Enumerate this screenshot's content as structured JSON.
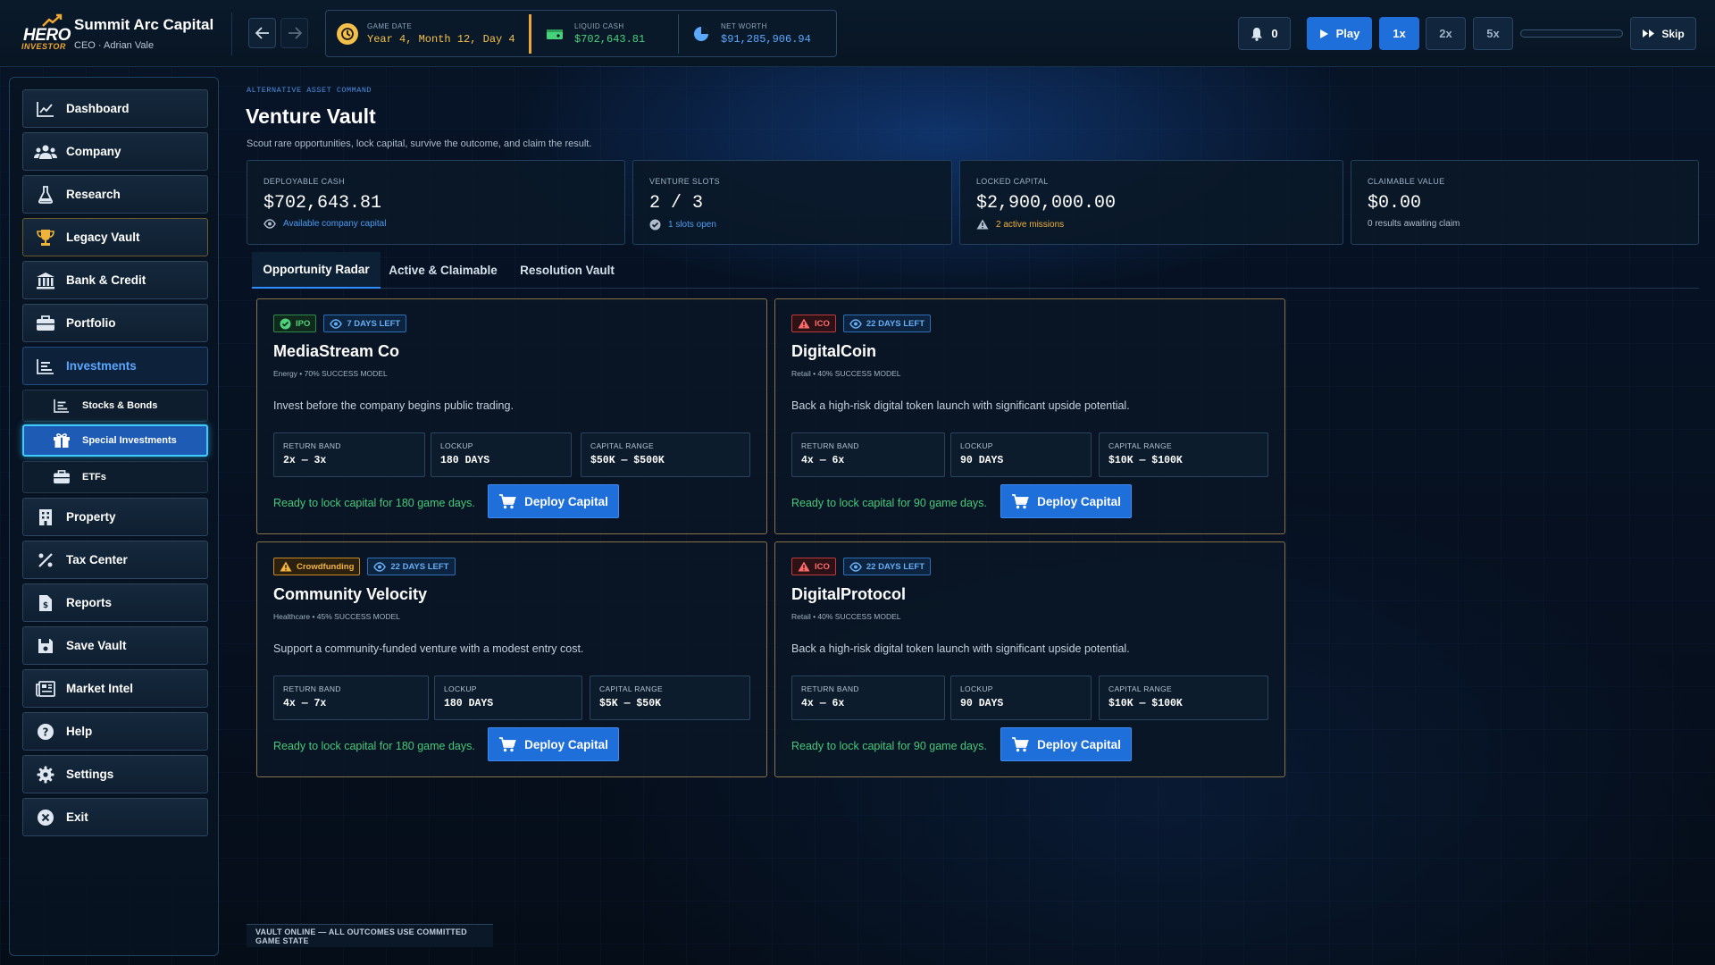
{
  "header": {
    "company": "Summit Arc Capital",
    "ceo": "CEO · Adrian Vale",
    "logo_top": "HERO",
    "logo_bottom": "INVESTOR",
    "stats": [
      {
        "label": "GAME DATE",
        "value": "Year 4, Month 12, Day 4",
        "color": "#f4c04a",
        "icon": "clock-icon"
      },
      {
        "label": "LIQUID CASH",
        "value": "$702,643.81",
        "color": "#46d17a",
        "icon": "cash-icon"
      },
      {
        "label": "NET WORTH",
        "value": "$91,285,906.94",
        "color": "#5aa9ff",
        "icon": "pie-chart-icon"
      }
    ],
    "notifications": "0",
    "play_label": "Play",
    "speeds": [
      "1x",
      "2x",
      "5x"
    ],
    "speed_selected": "1x",
    "progress": 0.0,
    "skip_label": "Skip"
  },
  "sidebar": {
    "items": [
      {
        "label": "Dashboard",
        "icon": "line-chart-icon"
      },
      {
        "label": "Company",
        "icon": "users-icon"
      },
      {
        "label": "Research",
        "icon": "flask-icon"
      },
      {
        "label": "Legacy Vault",
        "icon": "trophy-icon"
      },
      {
        "label": "Bank & Credit",
        "icon": "bank-icon"
      },
      {
        "label": "Portfolio",
        "icon": "briefcase-icon"
      },
      {
        "label": "Investments",
        "icon": "list-chart-icon"
      }
    ],
    "sub_items": [
      {
        "label": "Stocks & Bonds",
        "icon": "list-chart-icon"
      },
      {
        "label": "Special Investments",
        "icon": "gift-icon"
      },
      {
        "label": "ETFs",
        "icon": "briefcase-icon"
      }
    ],
    "items_after": [
      {
        "label": "Property",
        "icon": "building-icon"
      },
      {
        "label": "Tax Center",
        "icon": "percent-icon"
      },
      {
        "label": "Reports",
        "icon": "report-icon"
      },
      {
        "label": "Save Vault",
        "icon": "save-icon"
      },
      {
        "label": "Market Intel",
        "icon": "newspaper-icon"
      },
      {
        "label": "Help",
        "icon": "help-icon"
      },
      {
        "label": "Settings",
        "icon": "gear-icon"
      },
      {
        "label": "Exit",
        "icon": "close-icon"
      }
    ]
  },
  "main": {
    "eyebrow": "ALTERNATIVE ASSET COMMAND",
    "title": "Venture Vault",
    "subtitle": "Scout rare opportunities, lock capital, survive the outcome, and claim the result.",
    "kpis": [
      {
        "label": "DEPLOYABLE CASH",
        "value": "$702,643.81",
        "note": "Available company capital",
        "note_color": "#4d9cf0",
        "icon": "eye-icon"
      },
      {
        "label": "VENTURE SLOTS",
        "value": "2 / 3",
        "note": "1 slots open",
        "note_color": "#4d9cf0",
        "icon": "check-circle-icon"
      },
      {
        "label": "LOCKED CAPITAL",
        "value": "$2,900,000.00",
        "note": "2 active missions",
        "note_color": "#f0b03a",
        "icon": "warning-icon"
      },
      {
        "label": "CLAIMABLE VALUE",
        "value": "$0.00",
        "note": "0 results awaiting claim",
        "note_color": "#aebccb",
        "icon": ""
      }
    ],
    "tabs": [
      "Opportunity Radar",
      "Active & Claimable",
      "Resolution Vault"
    ],
    "tab_selected": "Opportunity Radar",
    "metric_labels": [
      "RETURN BAND",
      "LOCKUP",
      "CAPITAL RANGE"
    ],
    "deploy_label": "Deploy Capital",
    "cards": [
      {
        "type": "IPO",
        "type_class": "ipo",
        "days": "7 DAYS LEFT",
        "name": "MediaStream Co",
        "meta": "Energy • 70% SUCCESS MODEL",
        "desc": "Invest before the company begins public trading.",
        "return": "2x — 3x",
        "lockup": "180 DAYS",
        "range": "$50K — $500K",
        "ready": "Ready to lock capital for 180 game days."
      },
      {
        "type": "ICO",
        "type_class": "ico",
        "days": "22 DAYS LEFT",
        "name": "DigitalCoin",
        "meta": "Retail • 40% SUCCESS MODEL",
        "desc": "Back a high-risk digital token launch with significant upside potential.",
        "return": "4x — 6x",
        "lockup": "90 DAYS",
        "range": "$10K — $100K",
        "ready": "Ready to lock capital for 90 game days."
      },
      {
        "type": "Crowdfunding",
        "type_class": "crowd",
        "days": "22 DAYS LEFT",
        "name": "Community Velocity",
        "meta": "Healthcare • 45% SUCCESS MODEL",
        "desc": "Support a community-funded venture with a modest entry cost.",
        "return": "4x — 7x",
        "lockup": "180 DAYS",
        "range": "$5K — $50K",
        "ready": "Ready to lock capital for 180 game days."
      },
      {
        "type": "ICO",
        "type_class": "ico",
        "days": "22 DAYS LEFT",
        "name": "DigitalProtocol",
        "meta": "Retail • 40% SUCCESS MODEL",
        "desc": "Back a high-risk digital token launch with significant upside potential.",
        "return": "4x — 6x",
        "lockup": "90 DAYS",
        "range": "$10K — $100K",
        "ready": "Ready to lock capital for 90 game days."
      }
    ],
    "footer": "VAULT ONLINE — ALL OUTCOMES USE COMMITTED GAME STATE"
  }
}
